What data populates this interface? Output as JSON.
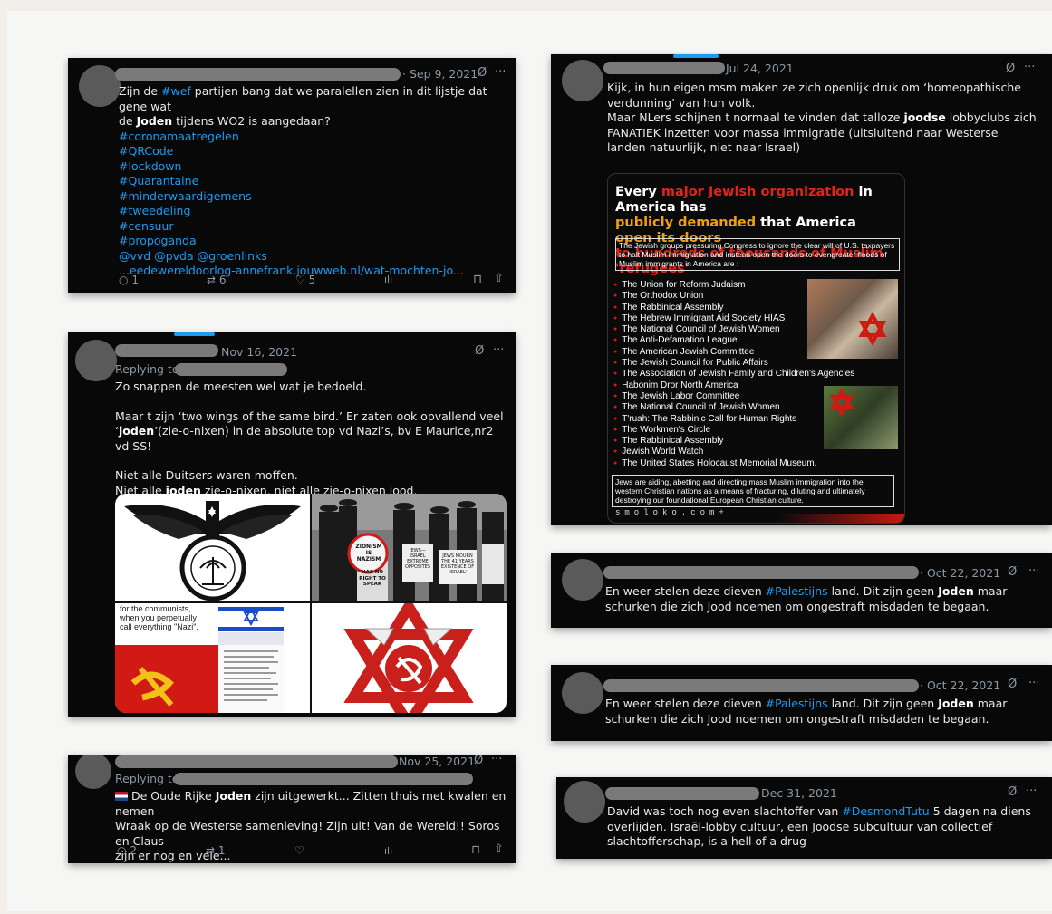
{
  "tweet1": {
    "date": "· Sep 9, 2021",
    "lines": [
      {
        "pre": "Zijn de ",
        "tag": "#wef",
        "post": " partijen bang dat we paralellen zien in dit lijstje dat gene wat"
      },
      {
        "bold": "de ",
        "b": "Joden",
        "post": " tijdens WO2 is aangedaan?"
      }
    ],
    "hashtags": [
      "#coronamaatregelen",
      "#QRCode",
      "#lockdown",
      "#Quarantaine",
      "#minderwaardigemens",
      "#tweedeling",
      "#censuur",
      "#propoganda",
      "@vvd @pvda @groenlinks",
      "...eedewereldoorlog-annefrank.jouwweb.nl/wat-mochten-jo..."
    ],
    "counts": {
      "reply": "1",
      "retweet": "6",
      "like": "5"
    }
  },
  "tweet2": {
    "date": "Nov 16, 2021",
    "replying": "Replying to",
    "p1": "Zo snappen de meesten wel wat je bedoeld.",
    "p2a": "Maar t zijn ‘two wings of the same bird.’ Er zaten ook opvallend veel",
    "p2b_pre": "‘",
    "p2b_bold": "joden",
    "p2b_post": "’(zie-o-nixen) in de absolute top vd Nazi’s, bv E Maurice,nr2 vd SS!",
    "p3a": "Niet alle Duitsers waren moffen.",
    "p3b_pre": "Niet alle ",
    "p3b_bold": "joden",
    "p3b_post": " zie-o-nixen, niet alle zie-o-nixen jood.",
    "img_caption": "for the communists, when you perpetually call everything \"Nazi\".",
    "sign_zionism": "ZIONISM IS NAZISM",
    "sign_jews": "JEWS—ISRAEL EXTREME OPPOSITES",
    "sign_mourn": "JEWS MOURN THE 41 YEARS EXISTENCE OF 'ISRAEL'",
    "sign_noright": "HAS NO RIGHT TO SPEAK"
  },
  "tweet3": {
    "date": "Nov 25, 2021",
    "replying": "Replying to",
    "line1_pre": " De Oude Rijke ",
    "line1_bold": "Joden",
    "line1_post": " zijn uitgewerkt... Zitten thuis met kwalen en nemen",
    "line2": "Wraak op de Westerse samenleving! Zijn uit! Van de Wereld!! Soros en Claus",
    "line3": "zijn er nog en vele...",
    "counts": {
      "reply": "2",
      "retweet": "1"
    }
  },
  "tweet4": {
    "date": "Jul 24, 2021",
    "l1": "Kijk, in hun eigen msm maken ze zich openlijk druk om  ‘homeopathische",
    "l2": "verdunning’ van hun volk.",
    "l3_pre": "Maar NLers schijnen t normaal te vinden dat talloze ",
    "l3_bold": "joodse",
    "l3_post": " lobbyclubs zich",
    "l4": "FANATIEK inzetten voor massa immigratie (uitsluitend naar Westerse",
    "l5": "landen natuurlijk, niet naar Israel)"
  },
  "poster": {
    "t1a": "Every ",
    "t1b": "major Jewish organization",
    "t1c": " in America has",
    "t2a": "publicly demanded",
    "t2b": " that America ",
    "t2c": "open its doors",
    "t3": "to hundreds of thousands of Muslim 'refugees'",
    "intro": "The Jewish groups pressuring Congress to ignore the clear will of U.S. taxpayers to halt Muslim immigration and instead open the doors to evengreater floods of Muslim immigrants in America are :",
    "orgs": [
      "The Union for Reform Judaism",
      "The Orthodox Union",
      "The Rabbinical Assembly",
      "The Hebrew Immigrant Aid Society HIAS",
      "The National Council of Jewish Women",
      "The Anti-Defamation League",
      "The American Jewish Committee",
      "The Jewish Council for Public Affairs",
      "The Association of Jewish Family and Children's Agencies",
      "Habonim Dror North America",
      "The Jewish Labor Committee",
      "The National Council of Jewish Women",
      "T'ruah: The Rabbinic Call for Human Rights",
      "The Workmen's Circle",
      "The Rabbinical Assembly",
      "Jewish World Watch",
      "The United States Holocaust Memorial Museum."
    ],
    "outro": "Jews are aiding, abetting and directing mass Muslim immigration into the western Christian nations as a means of fracturing, diluting and ultimately destroying our foundational European Christian culture.",
    "footer": "smoloko.com+"
  },
  "tweet5": {
    "date": "· Oct 22, 2021",
    "l1_pre": "En weer stelen deze dieven ",
    "l1_tag": "#Palestijns",
    "l1_mid": " land. Dit zijn geen ",
    "l1_bold": "Joden",
    "l1_post": " maar",
    "l2": "schurken die zich Jood noemen om ongestraft misdaden te begaan."
  },
  "tweet6": {
    "date": "· Oct 22, 2021",
    "l1_pre": "En weer stelen deze dieven ",
    "l1_tag": "#Palestijns",
    "l1_mid": " land. Dit zijn geen ",
    "l1_bold": "Joden",
    "l1_post": " maar",
    "l2": "schurken die zich Jood noemen om ongestraft misdaden te begaan."
  },
  "tweet7": {
    "date": "Dec 31, 2021",
    "l1_pre": "David was toch nog even slachtoffer van ",
    "l1_tag": "#DesmondTutu",
    "l1_post": " 5 dagen na diens",
    "l2": "overlijden. Israël-lobby cultuur, een Joodse subcultuur van collectief",
    "l3": "slachtofferschap, is a hell of a drug"
  },
  "icons": {
    "grok": "Ø",
    "more": "···",
    "reply": "○",
    "retweet": "⇄",
    "like": "♡",
    "views": "ılı",
    "bookmark": "⊓",
    "share": "⇧"
  }
}
